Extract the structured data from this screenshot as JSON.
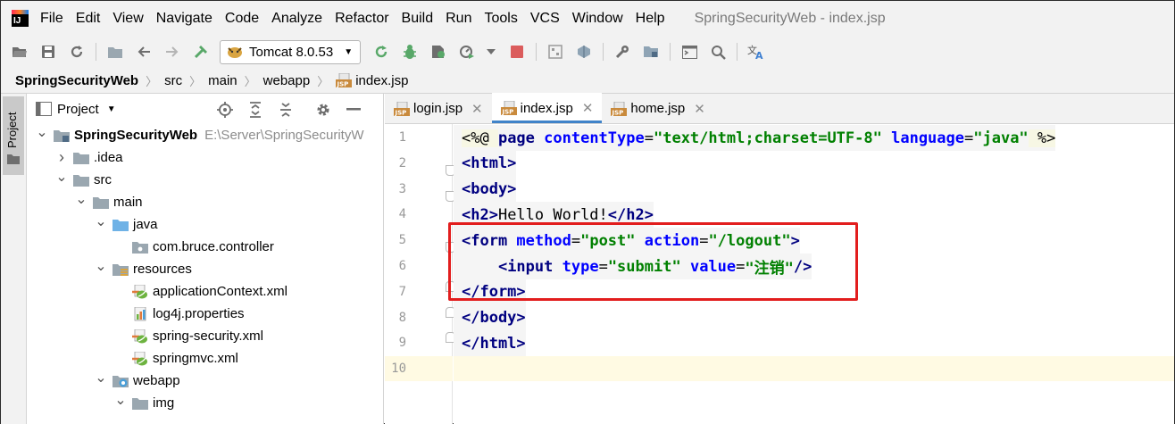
{
  "menu": {
    "logo": "IJ",
    "items": [
      "File",
      "Edit",
      "View",
      "Navigate",
      "Code",
      "Analyze",
      "Refactor",
      "Build",
      "Run",
      "Tools",
      "VCS",
      "Window",
      "Help"
    ],
    "title": "SpringSecurityWeb - index.jsp"
  },
  "toolbar": {
    "run_config": "Tomcat 8.0.53",
    "icons": [
      "open-icon",
      "save-icon",
      "sync-icon",
      "folder-icon",
      "back-icon",
      "forward-icon",
      "build-icon",
      "run-icon",
      "debug-icon",
      "coverage-icon",
      "profile-icon",
      "stop-icon",
      "project-structure-icon",
      "sdk-icon",
      "settings-icon",
      "modules-icon",
      "terminal-icon",
      "search-icon",
      "translate-icon"
    ]
  },
  "breadcrumb": [
    "SpringSecurityWeb",
    "src",
    "main",
    "webapp",
    "index.jsp"
  ],
  "tool_strip": {
    "label": "Project"
  },
  "project": {
    "title": "Project",
    "tree": [
      {
        "label": "SpringSecurityWeb",
        "hint": "E:\\Server\\SpringSecurityW",
        "depth": 0,
        "arrow": "down",
        "icon": "module",
        "bold": true
      },
      {
        "label": ".idea",
        "depth": 1,
        "arrow": "right",
        "icon": "folder"
      },
      {
        "label": "src",
        "depth": 1,
        "arrow": "down",
        "icon": "folder"
      },
      {
        "label": "main",
        "depth": 2,
        "arrow": "down",
        "icon": "folder"
      },
      {
        "label": "java",
        "depth": 3,
        "arrow": "down",
        "icon": "folder-blue"
      },
      {
        "label": "com.bruce.controller",
        "depth": 4,
        "arrow": "none",
        "icon": "package"
      },
      {
        "label": "resources",
        "depth": 3,
        "arrow": "down",
        "icon": "folder-res"
      },
      {
        "label": "applicationContext.xml",
        "depth": 4,
        "arrow": "none",
        "icon": "xml-spring"
      },
      {
        "label": "log4j.properties",
        "depth": 4,
        "arrow": "none",
        "icon": "properties"
      },
      {
        "label": "spring-security.xml",
        "depth": 4,
        "arrow": "none",
        "icon": "xml-spring"
      },
      {
        "label": "springmvc.xml",
        "depth": 4,
        "arrow": "none",
        "icon": "xml-spring"
      },
      {
        "label": "webapp",
        "depth": 3,
        "arrow": "down",
        "icon": "folder-web"
      },
      {
        "label": "img",
        "depth": 4,
        "arrow": "down",
        "icon": "folder"
      }
    ]
  },
  "editor": {
    "tabs": [
      {
        "label": "login.jsp",
        "active": false
      },
      {
        "label": "index.jsp",
        "active": true
      },
      {
        "label": "home.jsp",
        "active": false
      }
    ],
    "line_numbers": [
      "1",
      "2",
      "3",
      "4",
      "5",
      "6",
      "7",
      "8",
      "9",
      "10"
    ],
    "lines": [
      [
        [
          "dir",
          "<%@ "
        ],
        [
          "tag",
          "page "
        ],
        [
          "attr",
          "contentType"
        ],
        [
          "text",
          "="
        ],
        [
          "val",
          "\"text/html;charset=UTF-8\""
        ],
        [
          "text",
          " "
        ],
        [
          "attr",
          "language"
        ],
        [
          "text",
          "="
        ],
        [
          "val",
          "\"java\""
        ],
        [
          "dir",
          " %>"
        ]
      ],
      [
        [
          "tag",
          "<html>"
        ]
      ],
      [
        [
          "tag",
          "<body>"
        ]
      ],
      [
        [
          "tag",
          "<h2>"
        ],
        [
          "text",
          "Hello World!"
        ],
        [
          "tag",
          "</h2>"
        ]
      ],
      [
        [
          "tag",
          "<form "
        ],
        [
          "attr",
          "method"
        ],
        [
          "text",
          "="
        ],
        [
          "val",
          "\"post\""
        ],
        [
          "text",
          " "
        ],
        [
          "attr",
          "action"
        ],
        [
          "text",
          "="
        ],
        [
          "val",
          "\"/logout\""
        ],
        [
          "tag",
          ">"
        ]
      ],
      [
        [
          "text",
          "    "
        ],
        [
          "tag",
          "<input "
        ],
        [
          "attr",
          "type"
        ],
        [
          "text",
          "="
        ],
        [
          "val",
          "\"submit\""
        ],
        [
          "text",
          " "
        ],
        [
          "attr",
          "value"
        ],
        [
          "text",
          "="
        ],
        [
          "val",
          "\"注销\""
        ],
        [
          "tag",
          "/>"
        ]
      ],
      [
        [
          "tag",
          "</form>"
        ]
      ],
      [
        [
          "tag",
          "</body>"
        ]
      ],
      [
        [
          "tag",
          "</html>"
        ]
      ],
      []
    ]
  }
}
